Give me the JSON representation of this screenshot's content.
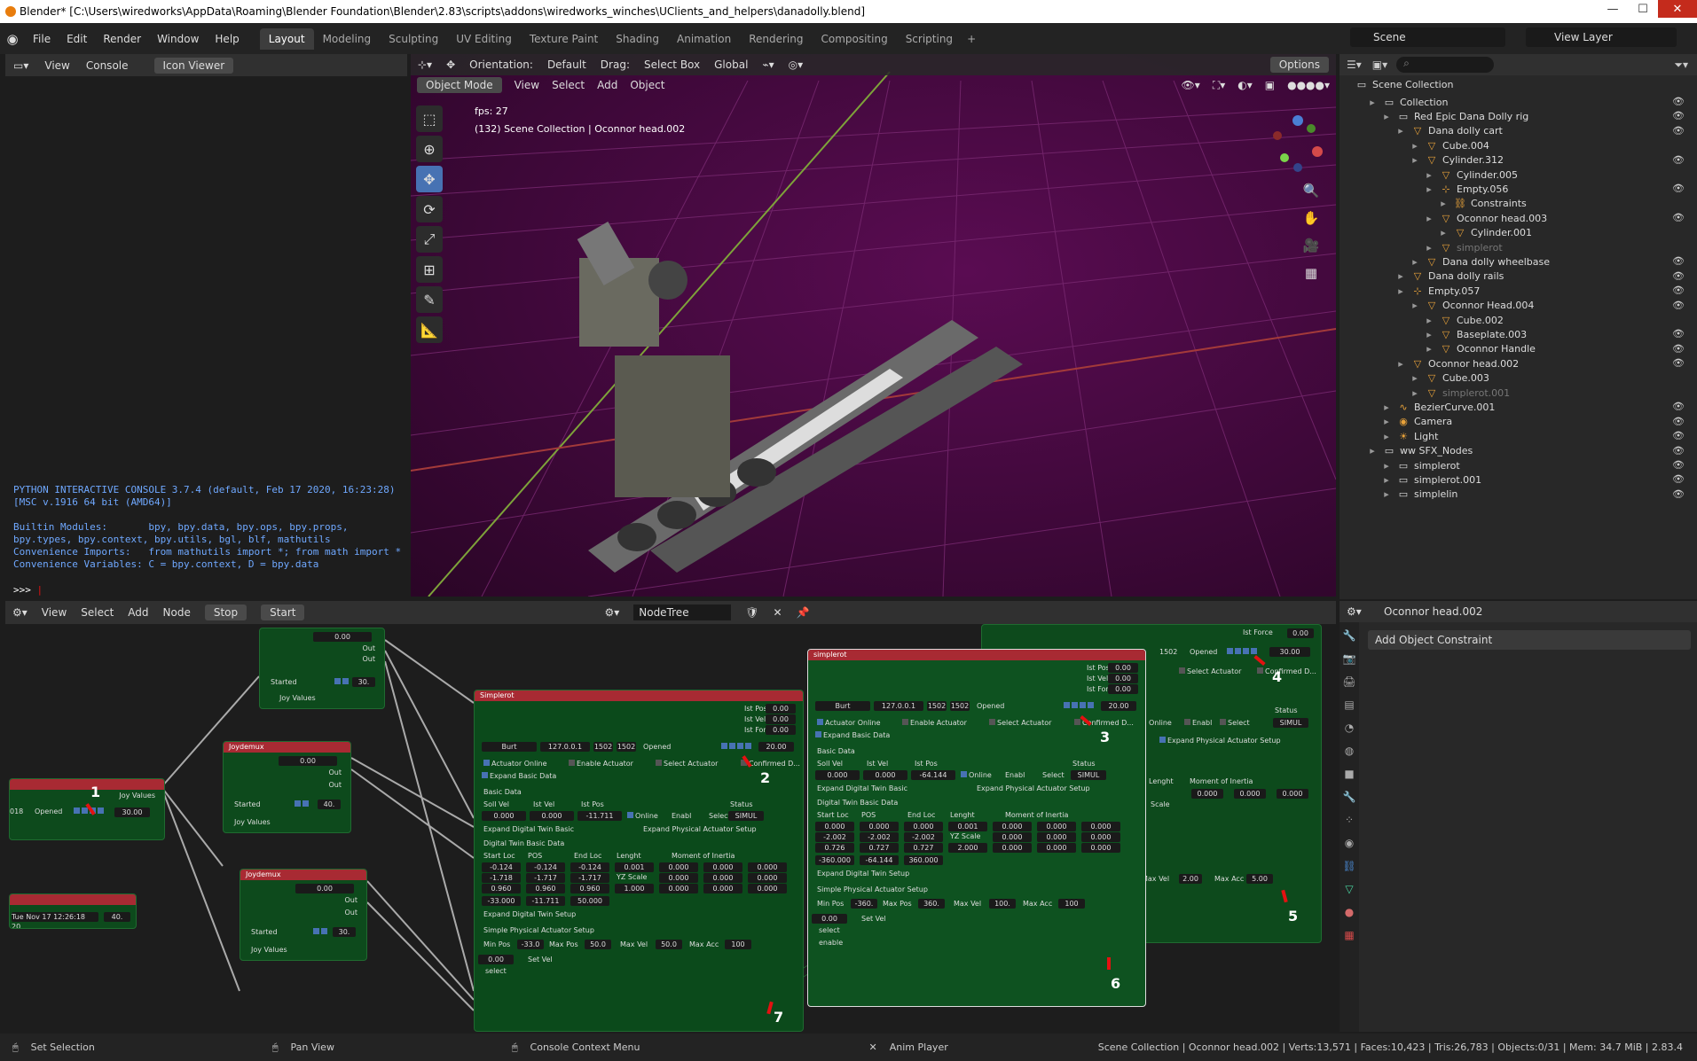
{
  "window": {
    "title": "Blender* [C:\\Users\\wiredworks\\AppData\\Roaming\\Blender Foundation\\Blender\\2.83\\scripts\\addons\\wiredworks_winches\\UClients_and_helpers\\danadolly.blend]"
  },
  "menu": [
    "File",
    "Edit",
    "Render",
    "Window",
    "Help"
  ],
  "workspaces": [
    "Layout",
    "Modeling",
    "Sculpting",
    "UV Editing",
    "Texture Paint",
    "Shading",
    "Animation",
    "Rendering",
    "Compositing",
    "Scripting"
  ],
  "active_workspace": "Layout",
  "scene": "Scene",
  "view_layer": "View Layer",
  "console": {
    "header": [
      "View",
      "Console"
    ],
    "icon_viewer": "Icon Viewer",
    "text": "PYTHON INTERACTIVE CONSOLE 3.7.4 (default, Feb 17 2020, 16:23:28) [MSC v.1916 64 bit (AMD64)]\n\nBuiltin Modules:       bpy, bpy.data, bpy.ops, bpy.props, bpy.types, bpy.context, bpy.utils, bgl, blf, mathutils\nConvenience Imports:   from mathutils import *; from math import *\nConvenience Variables: C = bpy.context, D = bpy.data",
    "prompt": ">>> "
  },
  "viewport": {
    "orientation_label": "Orientation:",
    "orientation": "Default",
    "drag_label": "Drag:",
    "drag": "Select Box",
    "transform": "Global",
    "options": "Options",
    "mode": "Object Mode",
    "menu": [
      "View",
      "Select",
      "Add",
      "Object"
    ],
    "fps": "fps: 27",
    "info": "(132) Scene Collection | Oconnor head.002"
  },
  "outliner": {
    "root": "Scene Collection",
    "rows": [
      {
        "label": "Collection",
        "indent": 0,
        "icon": "▭",
        "eye": true
      },
      {
        "label": "Red Epic Dana Dolly rig",
        "indent": 1,
        "icon": "▭",
        "eye": true
      },
      {
        "label": "Dana dolly cart",
        "indent": 2,
        "icon": "▽",
        "eye": true
      },
      {
        "label": "Cube.004",
        "indent": 3,
        "icon": "▽",
        "eye": false
      },
      {
        "label": "Cylinder.312",
        "indent": 3,
        "icon": "▽",
        "eye": true
      },
      {
        "label": "Cylinder.005",
        "indent": 4,
        "icon": "▽",
        "eye": false
      },
      {
        "label": "Empty.056",
        "indent": 4,
        "icon": "⊹",
        "eye": true
      },
      {
        "label": "Constraints",
        "indent": 5,
        "icon": "⛓",
        "eye": false
      },
      {
        "label": "Oconnor head.003",
        "indent": 4,
        "icon": "▽",
        "eye": true
      },
      {
        "label": "Cylinder.001",
        "indent": 5,
        "icon": "▽",
        "eye": false
      },
      {
        "label": "simplerot",
        "indent": 4,
        "icon": "▽",
        "eye": false,
        "dim": true
      },
      {
        "label": "Dana dolly wheelbase",
        "indent": 3,
        "icon": "▽",
        "eye": true
      },
      {
        "label": "Dana dolly rails",
        "indent": 2,
        "icon": "▽",
        "eye": true
      },
      {
        "label": "Empty.057",
        "indent": 2,
        "icon": "⊹",
        "eye": true
      },
      {
        "label": "Oconnor Head.004",
        "indent": 3,
        "icon": "▽",
        "eye": true
      },
      {
        "label": "Cube.002",
        "indent": 4,
        "icon": "▽",
        "eye": false
      },
      {
        "label": "Baseplate.003",
        "indent": 4,
        "icon": "▽",
        "eye": true
      },
      {
        "label": "Oconnor Handle",
        "indent": 4,
        "icon": "▽",
        "eye": true
      },
      {
        "label": "Oconnor head.002",
        "indent": 2,
        "icon": "▽",
        "eye": true
      },
      {
        "label": "Cube.003",
        "indent": 3,
        "icon": "▽",
        "eye": false
      },
      {
        "label": "simplerot.001",
        "indent": 3,
        "icon": "▽",
        "eye": false,
        "dim": true
      },
      {
        "label": "BezierCurve.001",
        "indent": 1,
        "icon": "∿",
        "eye": true
      },
      {
        "label": "Camera",
        "indent": 1,
        "icon": "◉",
        "eye": true
      },
      {
        "label": "Light",
        "indent": 1,
        "icon": "☀",
        "eye": true
      },
      {
        "label": "ww SFX_Nodes",
        "indent": 0,
        "icon": "▭",
        "eye": true
      },
      {
        "label": "simplerot",
        "indent": 1,
        "icon": "▭",
        "eye": true
      },
      {
        "label": "simplerot.001",
        "indent": 1,
        "icon": "▭",
        "eye": true
      },
      {
        "label": "simplelin",
        "indent": 1,
        "icon": "▭",
        "eye": true
      }
    ]
  },
  "properties": {
    "object": "Oconnor head.002",
    "add_constraint": "Add Object Constraint"
  },
  "node_editor": {
    "menu": [
      "View",
      "Select",
      "Add",
      "Node"
    ],
    "stop": "Stop",
    "start": "Start",
    "tree": "NodeTree",
    "joydemux_1": {
      "title": "Joydemux",
      "out": "Out",
      "val": "0.00",
      "started": "Started",
      "v30": "30.",
      "joy": "Joy Values"
    },
    "joydemux_2": {
      "title": "Joydemux",
      "out": "Out",
      "val": "0.00",
      "started": "Started",
      "v40": "40.",
      "joy": "Joy Values"
    },
    "joydemux_3": {
      "title": "Joydemux",
      "out": "Out",
      "val": "0.00",
      "started": "Started",
      "v30": "30.",
      "joy": "Joy Values"
    },
    "left_node": {
      "opened": "Opened",
      "v30": "30.00",
      "joy": "Joy Values",
      "num": "018"
    },
    "left_node_2": {
      "date": "Tue Nov 17 12:26:18 20...",
      "v40": "40."
    },
    "simplerot_1": {
      "title": "Simplerot",
      "ist_pos": "Ist Pos",
      "ist_vel": "Ist Vel",
      "ist_force": "Ist Force",
      "v0": "0.00",
      "burt": "Burt",
      "ip": "127.0.0.1",
      "p1": "1502",
      "p2": "1502",
      "opened": "Opened",
      "v20": "20.00",
      "act_online": "Actuator Online",
      "enable_act": "Enable Actuator",
      "select_act": "Select Actuator",
      "confirmed": "Confirmed D...",
      "expand_basic": "Expand Basic Data",
      "basic": "Basic Data",
      "soll_vel": "Soll Vel",
      "ist_vel2": "Ist Vel",
      "ist_pos2": "Ist Pos",
      "status": "Status",
      "sv": "0.000",
      "iv": "0.000",
      "ip2": "-11.711",
      "online": "Online",
      "enabl": "Enabl",
      "select": "Select",
      "simul": "SIMUL",
      "exp_dt": "Expand Digital Twin Basic",
      "exp_phys": "Expand Physical Actuator Setup",
      "dtbd": "Digital Twin Basic Data",
      "start_loc": "Start Loc",
      "pos": "POS",
      "end_loc": "End Loc",
      "lenght": "Lenght",
      "moi": "Moment of Inertia",
      "r1": [
        "-0.124",
        "-0.124",
        "-0.124",
        "0.001",
        "0.000",
        "0.000",
        "0.000"
      ],
      "r2": [
        "-1.718",
        "-1.717",
        "-1.717",
        "0.000",
        "0.000",
        "0.000"
      ],
      "r3": [
        "0.960",
        "0.960",
        "0.960",
        "1.000",
        "0.000",
        "0.000",
        "0.000"
      ],
      "yz": "YZ Scale",
      "lim": [
        "-33.000",
        "-11.711",
        "50.000"
      ],
      "exp_dt_setup": "Expand Digital Twin Setup",
      "sps": "Simple Physical Actuator Setup",
      "minpos": "Min Pos",
      "minposv": "-33.0",
      "maxpos": "Max Pos",
      "maxposv": "50.0",
      "maxvel": "Max Vel",
      "maxvelv": "50.0",
      "maxacc": "Max Acc",
      "maxaccv": "100",
      "setvel": "Set Vel",
      "setvelv": "0.00",
      "selectlbl": "select"
    },
    "simplerot_2": {
      "title": "simplerot",
      "ist_pos": "Ist Pos",
      "ist_vel": "Ist Vel",
      "ist_force": "Ist Force",
      "v0": "0.00",
      "burt": "Burt",
      "ip": "127.0.0.1",
      "p1": "1502",
      "p2": "1502",
      "opened": "Opened",
      "v20": "20.00",
      "act_online": "Actuator Online",
      "enable_act": "Enable Actuator",
      "select_act": "Select Actuator",
      "confirmed": "Confirmed D...",
      "expand_basic": "Expand Basic Data",
      "basic": "Basic Data",
      "soll_vel": "Soll Vel",
      "ist_vel2": "Ist Vel",
      "ist_pos2": "Ist Pos",
      "status": "Status",
      "sv": "0.000",
      "iv": "0.000",
      "ip2": "-64.144",
      "online": "Online",
      "enabl": "Enabl",
      "select": "Select",
      "simul": "SIMUL",
      "exp_dt": "Expand Digital Twin Basic",
      "exp_phys": "Expand Physical Actuator Setup",
      "dtbd": "Digital Twin Basic Data",
      "start_loc": "Start Loc",
      "pos": "POS",
      "end_loc": "End Loc",
      "lenght": "Lenght",
      "moi": "Moment of Inertia",
      "r1": [
        "0.000",
        "0.000",
        "0.000",
        "0.001",
        "0.000",
        "0.000",
        "0.000"
      ],
      "r2": [
        "-2.002",
        "-2.002",
        "-2.002",
        "0.000",
        "0.000",
        "0.000"
      ],
      "r3": [
        "0.726",
        "0.727",
        "0.727",
        "2.000",
        "0.000",
        "0.000",
        "0.000"
      ],
      "yz": "YZ Scale",
      "lim": [
        "-360.000",
        "-64.144",
        "360.000"
      ],
      "exp_dt_setup": "Expand Digital Twin Setup",
      "sps": "Simple Physical Actuator Setup",
      "minpos": "Min Pos",
      "minposv": "-360.",
      "maxpos": "Max Pos",
      "maxposv": "360.",
      "maxvel": "Max Vel",
      "maxvelv": "100.",
      "maxacc": "Max Acc",
      "maxaccv": "100",
      "setvel": "Set Vel",
      "setvelv": "0.00",
      "selectlbl": "select",
      "enablelbl": "enable"
    },
    "right_node": {
      "ist_force": "Ist Force",
      "v0": "0.00",
      "p": "1502",
      "opened": "Opened",
      "v30": "30.00",
      "select_act": "Select Actuator",
      "confirmed": "Confirmed D...",
      "online": "Online",
      "enabl": "Enabl",
      "select": "Select",
      "status": "Status",
      "simul": "SIMUL",
      "exp_phys": "Expand Physical Actuator Setup",
      "lenght": "Lenght",
      "moi": "Moment of Inertia",
      "vals": [
        "0.000",
        "0.000",
        "0.000",
        "0.000"
      ],
      "scale": "Scale",
      "maxvel": "Max Vel",
      "maxvelv": "2.00",
      "maxacc": "Max Acc",
      "maxaccv": "5.00"
    },
    "markers": [
      "1",
      "2",
      "3",
      "4",
      "5",
      "6",
      "7"
    ]
  },
  "status_bar": {
    "set_selection": "Set Selection",
    "pan_view": "Pan View",
    "console_menu": "Console Context Menu",
    "anim_player": "Anim Player",
    "stats": "Scene Collection | Oconnor head.002 | Verts:13,571 | Faces:10,423 | Tris:26,783 | Objects:0/31 | Mem: 34.7 MiB | 2.83.4"
  }
}
